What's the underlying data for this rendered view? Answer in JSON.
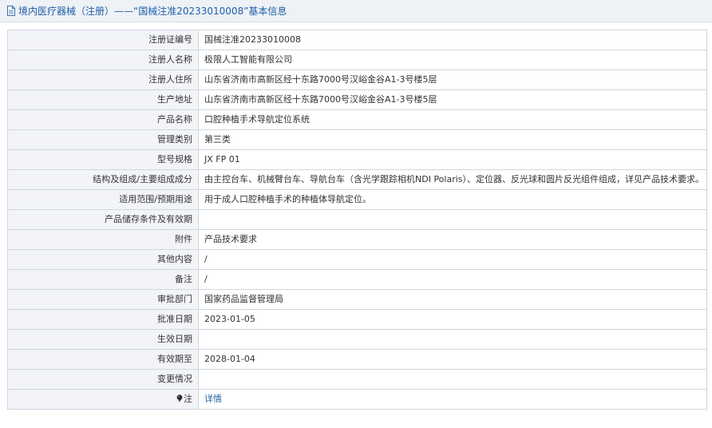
{
  "header": {
    "title": "境内医疗器械（注册）——“国械注准20233010008”基本信息"
  },
  "rows": [
    {
      "label": "注册证编号",
      "value": "国械注准20233010008"
    },
    {
      "label": "注册人名称",
      "value": "极限人工智能有限公司"
    },
    {
      "label": "注册人住所",
      "value": "山东省济南市高新区经十东路7000号汉峪金谷A1-3号楼5层"
    },
    {
      "label": "生产地址",
      "value": "山东省济南市高新区经十东路7000号汉峪金谷A1-3号楼5层"
    },
    {
      "label": "产品名称",
      "value": "口腔种植手术导航定位系统"
    },
    {
      "label": "管理类别",
      "value": "第三类"
    },
    {
      "label": "型号规格",
      "value": "JX FP 01"
    },
    {
      "label": "结构及组成/主要组成成分",
      "value": "由主控台车、机械臂台车、导航台车（含光学跟踪相机NDI Polaris）、定位器、反光球和圆片反光组件组成，详见产品技术要求。"
    },
    {
      "label": "适用范围/预期用途",
      "value": "用于成人口腔种植手术的种植体导航定位。"
    },
    {
      "label": "产品储存条件及有效期",
      "value": ""
    },
    {
      "label": "附件",
      "value": "产品技术要求"
    },
    {
      "label": "其他内容",
      "value": "/"
    },
    {
      "label": "备注",
      "value": "/"
    },
    {
      "label": "审批部门",
      "value": "国家药品监督管理局"
    },
    {
      "label": "批准日期",
      "value": "2023-01-05"
    },
    {
      "label": "生效日期",
      "value": ""
    },
    {
      "label": "有效期至",
      "value": "2028-01-04"
    },
    {
      "label": "变更情况",
      "value": ""
    }
  ],
  "note_row": {
    "label": "注",
    "icon": "pin-icon",
    "link": "详情"
  }
}
